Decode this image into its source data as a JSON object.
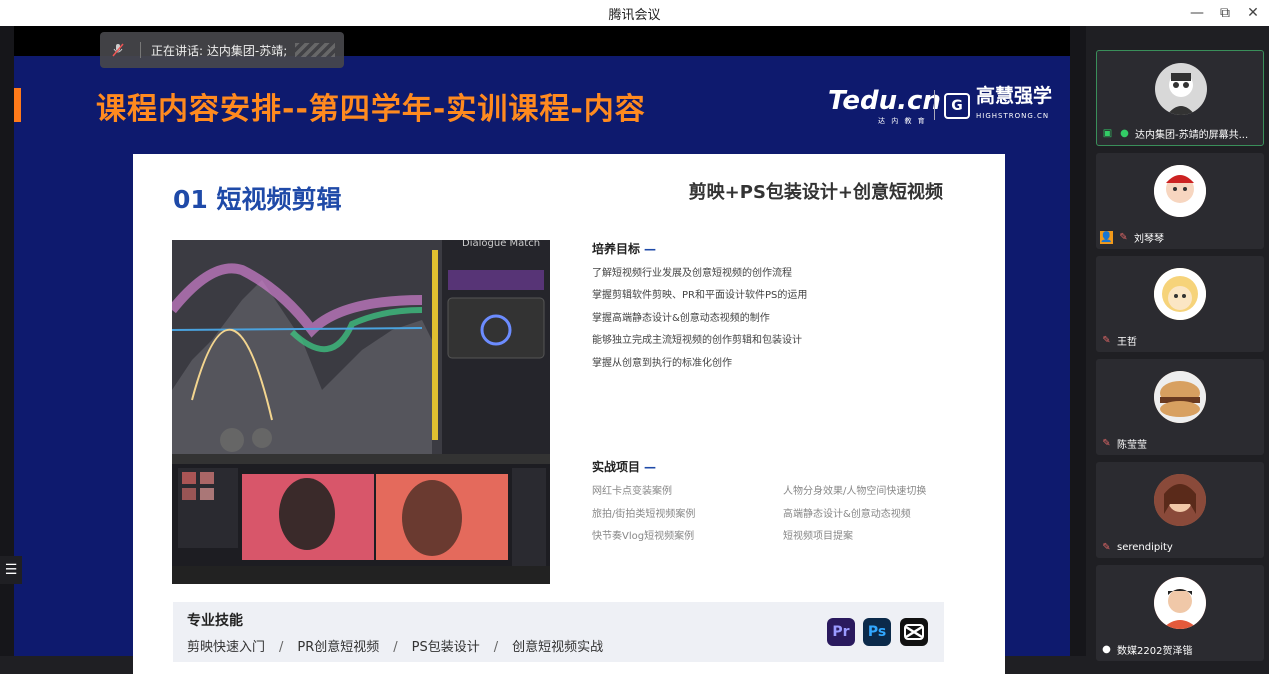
{
  "window": {
    "title": "腾讯会议",
    "minimize": "—",
    "restore": "⧉",
    "close": "✕"
  },
  "speaking_banner": {
    "text": "正在讲话: 达内集团-苏靖;"
  },
  "slide": {
    "main_title": "课程内容安排--第四学年-实训课程-内容",
    "logo_tedu": "Tedu.cn",
    "logo_tedu_sub": "达 内 教 育",
    "logo_hs_mark": "G",
    "logo_hs_cn": "高慧强学",
    "logo_hs_en": "HIGHSTRONG.CN",
    "section_title": "01 短视频剪辑",
    "section_subtitle": "剪映+PS包装设计+创意短视频",
    "goals": {
      "title": "培养目标",
      "dash": "—",
      "items": [
        "了解短视频行业发展及创意短视频的创作流程",
        "掌握剪辑软件剪映、PR和平面设计软件PS的运用",
        "掌握高端静态设计&创意动态视频的制作",
        "能够独立完成主流短视频的创作剪辑和包装设计",
        "掌握从创意到执行的标准化创作"
      ]
    },
    "projects": {
      "title": "实战项目",
      "dash": "—",
      "left": [
        "网红卡点变装案例",
        "旅拍/街拍类短视频案例",
        "快节奏Vlog短视频案例"
      ],
      "right": [
        "人物分身效果/人物空间快速切换",
        "高端静态设计&创意动态视频",
        "短视频项目提案"
      ]
    },
    "skills": {
      "title": "专业技能",
      "items": [
        "剪映快速入门",
        "PR创意短视频",
        "PS包装设计",
        "创意短视频实战"
      ],
      "separator": "/"
    },
    "app_icons": [
      {
        "name": "Pr",
        "bg": "#2a1a5e",
        "fg": "#9b9bff"
      },
      {
        "name": "Ps",
        "bg": "#0b2a4a",
        "fg": "#31a8ff"
      },
      {
        "name": "capcut",
        "bg": "#111111",
        "fg": "#ffffff"
      }
    ],
    "editor_screenshot_label": "Dialogue Match"
  },
  "participants": [
    {
      "name": "达内集团-苏靖的屏幕共...",
      "status": "speaking-share",
      "avatar_color": "#d8d8d8"
    },
    {
      "name": "刘琴琴",
      "status": "muted-host",
      "avatar_color": "#f3c9b0"
    },
    {
      "name": "王哲",
      "status": "muted",
      "avatar_color": "#f6d37a"
    },
    {
      "name": "陈莹莹",
      "status": "muted",
      "avatar_color": "#c89060"
    },
    {
      "name": "serendipity",
      "status": "muted",
      "avatar_color": "#b46b50"
    },
    {
      "name": "数媒2202贺泽锴",
      "status": "live",
      "avatar_color": "#e35a3c"
    }
  ],
  "colors": {
    "slide_bg": "#0e1a6e",
    "title_orange": "#ff8a1f",
    "section_blue": "#1f4aa8"
  }
}
